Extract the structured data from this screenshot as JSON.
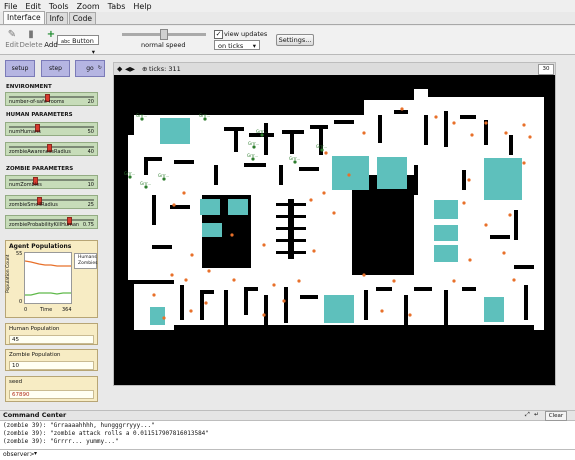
{
  "menu": [
    "File",
    "Edit",
    "Tools",
    "Zoom",
    "Tabs",
    "Help"
  ],
  "tabs": [
    "Interface",
    "Info",
    "Code"
  ],
  "toolbar": {
    "edit": "Edit",
    "delete": "Delete",
    "add": "Add",
    "widget_type": "Button",
    "speed_label": "normal speed",
    "view_updates": "view updates",
    "update_mode": "on ticks",
    "settings": "Settings..."
  },
  "buttons": {
    "setup": "setup",
    "step": "step",
    "go": "go"
  },
  "sections": {
    "environment": "ENVIRONMENT",
    "human": "HUMAN PARAMETERS",
    "zombie": "ZOMBIE PARAMETERS"
  },
  "sliders": [
    {
      "name": "number-of-safe-rooms",
      "value": "20",
      "fraction": 0.45
    },
    {
      "name": "numHumans",
      "value": "50",
      "fraction": 0.32
    },
    {
      "name": "zombieAwarenessRadius",
      "value": "40",
      "fraction": 0.48
    },
    {
      "name": "numZombies",
      "value": "10",
      "fraction": 0.3
    },
    {
      "name": "zombieSmellRadius",
      "value": "25",
      "fraction": 0.35
    },
    {
      "name": "zombieProbabilityKillHuman",
      "value": "0.75",
      "fraction": 0.72
    }
  ],
  "plot": {
    "title": "Agent Populations",
    "ylabel": "Population Count",
    "xlabel": "Time",
    "ymax": "55",
    "ymin": "0",
    "xmin": "0",
    "xmax": "364",
    "legend": [
      "Humans",
      "Zombies"
    ],
    "colors": {
      "humans": "#e8702a",
      "zombies": "#5fb94a"
    }
  },
  "monitors": [
    {
      "title": "Human Population",
      "value": "45"
    },
    {
      "title": "Zombie Population",
      "value": "10"
    },
    {
      "title": "seed",
      "value": "67890"
    }
  ],
  "view": {
    "ticks_label": "ticks: 311",
    "zoom_value": "30"
  },
  "zombie_label": "Grrr...",
  "command_center": {
    "title": "Command Center",
    "clear": "Clear",
    "lines": [
      "(zombie 39): \"Grraaaahhhh, hungggrryyy...\"",
      "(zombie 39): \"zombie attack rolls a 0.011517907816013584\"",
      "(zombie 39): \"Grrrr... yummy...\""
    ],
    "prompt": "observer>"
  }
}
